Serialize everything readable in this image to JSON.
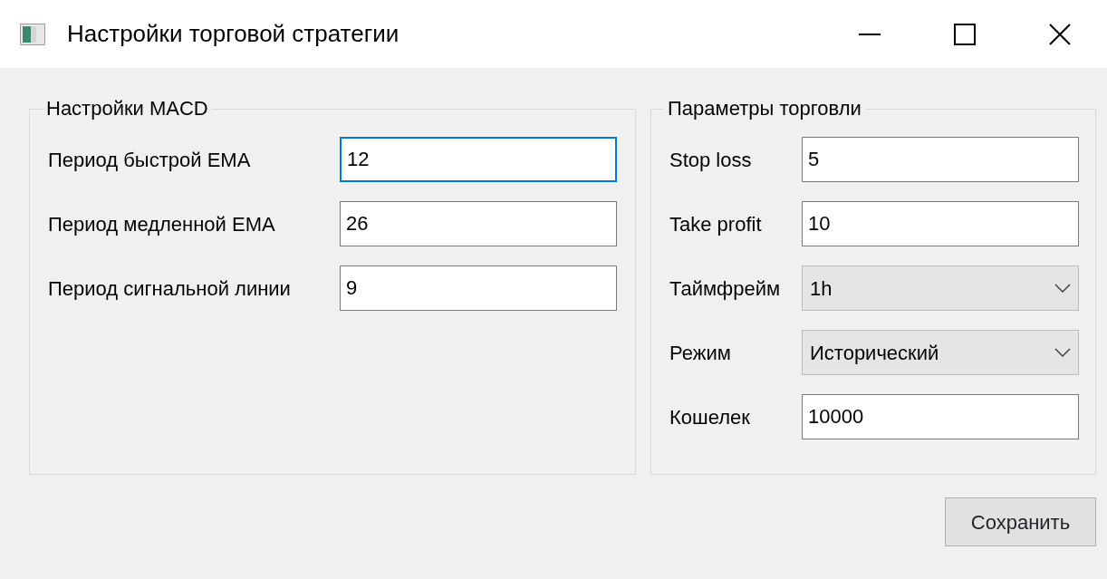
{
  "window": {
    "title": "Настройки торговой стратегии"
  },
  "macd_group": {
    "title": "Настройки MACD",
    "fields": [
      {
        "kind": "input",
        "label": "Период быстрой EMA",
        "value": "12",
        "focused": true
      },
      {
        "kind": "input",
        "label": "Период медленной EMA",
        "value": "26",
        "focused": false
      },
      {
        "kind": "input",
        "label": "Период сигнальной линии",
        "value": "9",
        "focused": false
      }
    ]
  },
  "trade_group": {
    "title": "Параметры торговли",
    "fields": [
      {
        "kind": "input",
        "label": "Stop loss",
        "value": "5",
        "focused": false
      },
      {
        "kind": "input",
        "label": "Take profit",
        "value": "10",
        "focused": false
      },
      {
        "kind": "combo",
        "label": "Таймфрейм",
        "value": "1h",
        "focused": false
      },
      {
        "kind": "combo",
        "label": "Режим",
        "value": "Исторический",
        "focused": false
      },
      {
        "kind": "input",
        "label": "Кошелек",
        "value": "10000",
        "focused": false
      }
    ]
  },
  "buttons": [
    {
      "label": "Сохранить"
    }
  ]
}
